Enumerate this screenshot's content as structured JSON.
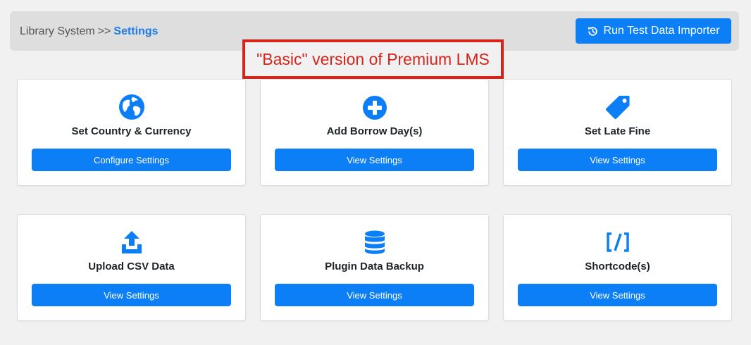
{
  "breadcrumb": {
    "root": "Library System",
    "separator": ">>",
    "current": "Settings"
  },
  "header": {
    "run_importer_label": "Run Test Data Importer"
  },
  "annotation": {
    "text": "\"Basic\" version of Premium LMS"
  },
  "cards": [
    {
      "icon": "globe-icon",
      "title": "Set Country & Currency",
      "button_label": "Configure Settings"
    },
    {
      "icon": "plus-circle-icon",
      "title": "Add Borrow Day(s)",
      "button_label": "View Settings"
    },
    {
      "icon": "tag-icon",
      "title": "Set Late Fine",
      "button_label": "View Settings"
    },
    {
      "icon": "upload-icon",
      "title": "Upload CSV Data",
      "button_label": "View Settings"
    },
    {
      "icon": "database-icon",
      "title": "Plugin Data Backup",
      "button_label": "View Settings"
    },
    {
      "icon": "shortcode-icon",
      "title": "Shortcode(s)",
      "button_label": "View Settings"
    }
  ],
  "colors": {
    "accent": "#0d7ff6",
    "breadcrumb_current": "#1e7be6",
    "annotation": "#d4251d",
    "background": "#f1f1f1",
    "topbar": "#dedede"
  }
}
